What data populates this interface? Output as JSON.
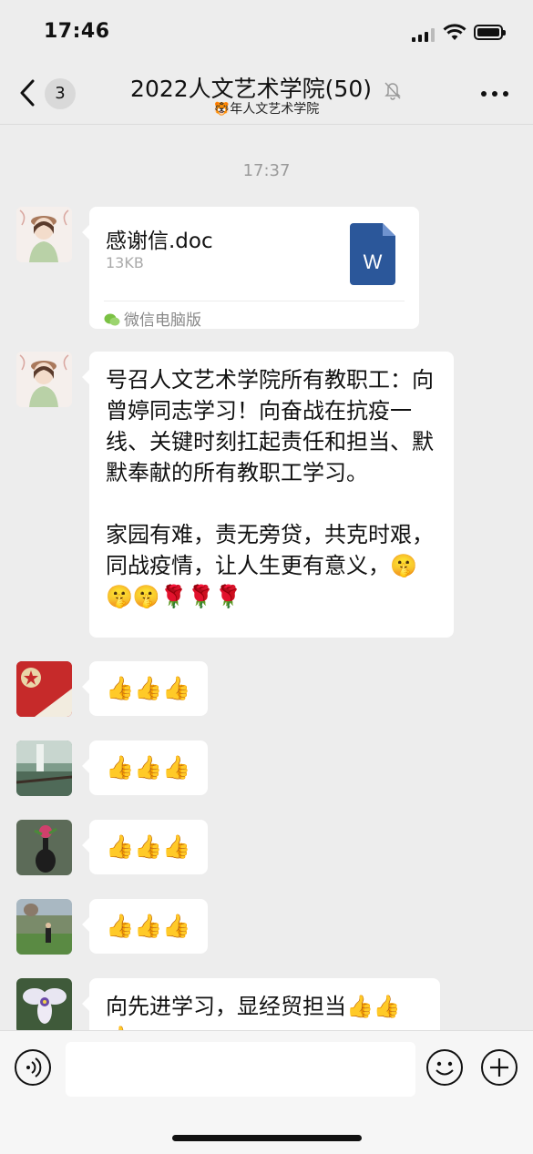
{
  "status": {
    "time": "17:46"
  },
  "header": {
    "unread_count": "3",
    "title": "2022人文艺术学院(50)",
    "subtitle": "🐯年人文艺术学院"
  },
  "chat": {
    "timestamp": "17:37",
    "messages": [
      {
        "type": "file",
        "filename": "感谢信.doc",
        "size": "13KB",
        "source": "微信电脑版",
        "file_icon_letter": "W"
      },
      {
        "type": "text",
        "text": "号召人文艺术学院所有教职工：向曾婷同志学习！向奋战在抗疫一线、关键时刻扛起责任和担当、默默奉献的所有教职工学习。\n\n家园有难，责无旁贷，共克时艰，同战疫情，让人生更有意义，🤫🤫🤫🌹🌹🌹"
      },
      {
        "type": "text",
        "text": "👍👍👍"
      },
      {
        "type": "text",
        "text": "👍👍👍"
      },
      {
        "type": "text",
        "text": "👍👍👍"
      },
      {
        "type": "text",
        "text": "👍👍👍"
      },
      {
        "type": "text",
        "text": "向先进学习，显经贸担当👍👍👍"
      }
    ]
  },
  "colors": {
    "background": "#ededed",
    "bubble": "#ffffff",
    "word_blue": "#2b579a",
    "muted_text": "#9a9a9a"
  },
  "icons": [
    "back-chevron-icon",
    "mute-bell-icon",
    "more-icon",
    "wechat-icon",
    "voice-icon",
    "emoji-icon",
    "plus-icon"
  ]
}
